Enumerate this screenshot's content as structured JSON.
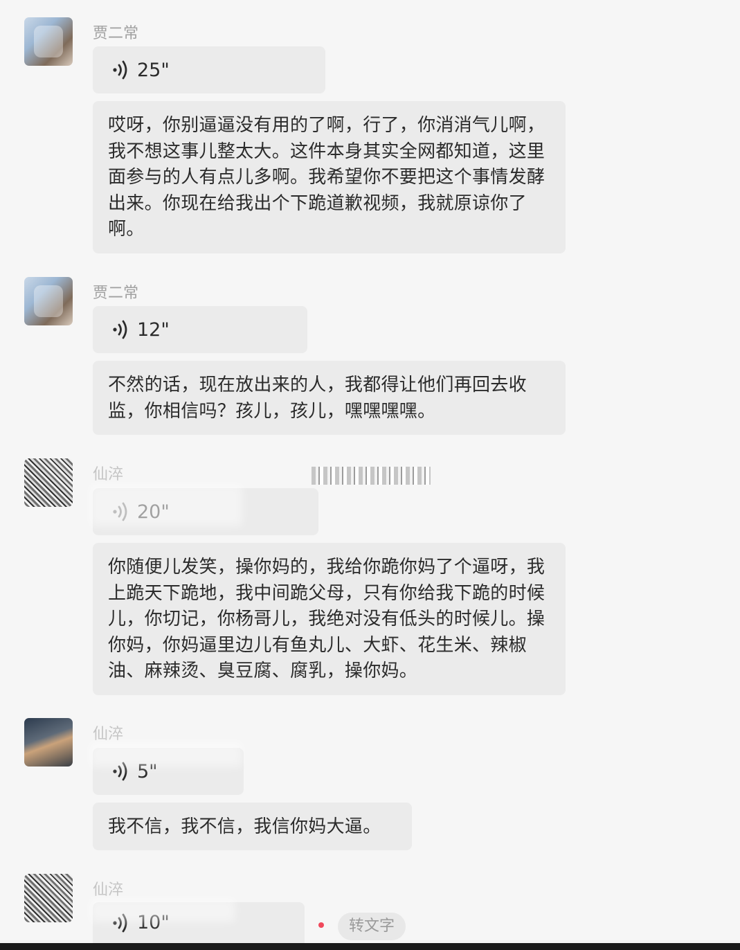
{
  "messages": [
    {
      "sender": "贾二常",
      "voice_duration": "25\"",
      "transcript": "哎呀，你别逼逼没有用的了啊，行了，你消消气儿啊，我不想这事儿整太大。这件本身其实全网都知道，这里面参与的人有点儿多啊。我希望你不要把这个事情发酵出来。你现在给我出个下跪道歉视频，我就原谅你了啊。"
    },
    {
      "sender": "贾二常",
      "voice_duration": "12\"",
      "transcript": "不然的话，现在放出来的人，我都得让他们再回去收监，你相信吗？孩儿，孩儿，嘿嘿嘿嘿。"
    },
    {
      "sender": "仙淬",
      "voice_duration": "20\"",
      "transcript": "你随便儿发笑，操你妈的，我给你跪你妈了个逼呀，我上跪天下跪地，我中间跪父母，只有你给我下跪的时候儿，你切记，你杨哥儿，我绝对没有低头的时候儿。操你妈，你妈逼里边儿有鱼丸儿、大虾、花生米、辣椒油、麻辣烫、臭豆腐、腐乳，操你妈。"
    },
    {
      "sender": "仙淬",
      "voice_duration": "5\"",
      "transcript": "我不信，我不信，我信你妈大逼。"
    },
    {
      "sender": "仙淬",
      "voice_duration": "10\"",
      "transcript_button": "转文字"
    }
  ],
  "colors": {
    "background": "#f6f6f6",
    "bubble": "#ebebeb",
    "unread_dot": "#f0485b"
  },
  "icons": {
    "voice": "voice-wave-icon"
  }
}
